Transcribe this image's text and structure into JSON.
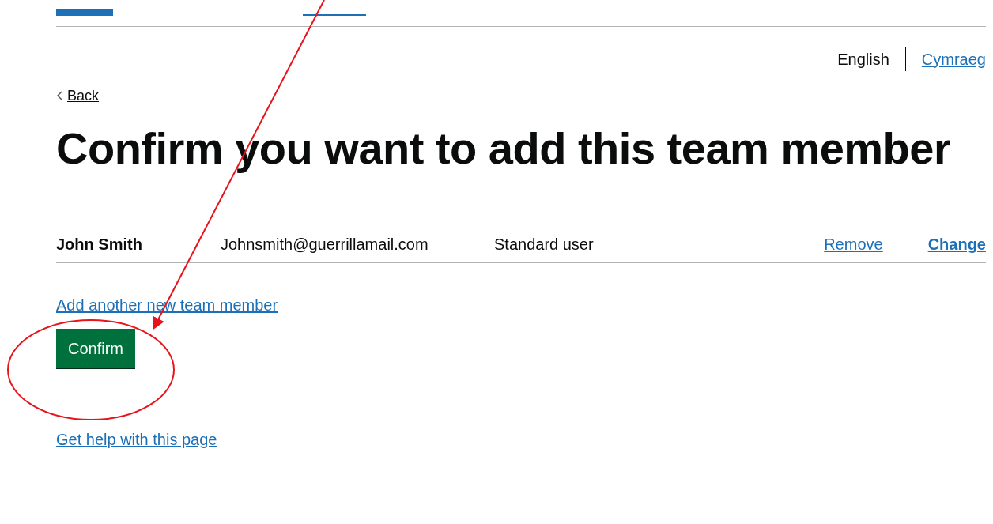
{
  "languages": [
    {
      "label": "English",
      "selected": true
    },
    {
      "label": "Cymraeg",
      "selected": false
    }
  ],
  "back_link": "Back",
  "heading": "Confirm you want to add this team member",
  "members": [
    {
      "name": "John Smith",
      "email": "Johnsmith@guerrillamail.com",
      "role": "Standard user",
      "actions": [
        "Remove",
        "Change"
      ]
    }
  ],
  "add_link": "Add another new team member",
  "confirm_button": "Confirm",
  "help_link": "Get help with this page"
}
